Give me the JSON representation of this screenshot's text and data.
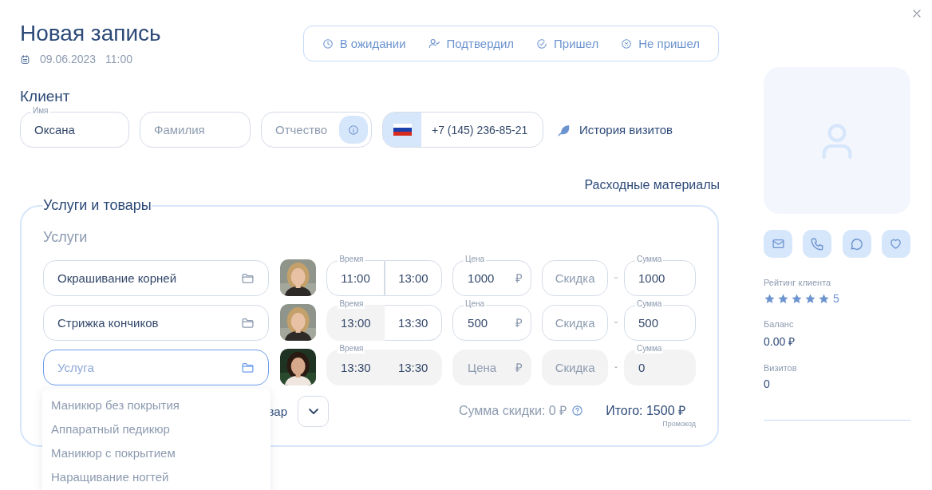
{
  "title": "Новая запись",
  "date": "09.06.2023",
  "time": "11:00",
  "statuses": [
    {
      "kind": "waiting",
      "label": "В ожидании"
    },
    {
      "kind": "confirmed",
      "label": "Подтвердил"
    },
    {
      "kind": "came",
      "label": "Пришел"
    },
    {
      "kind": "no_show",
      "label": "Не пришел"
    }
  ],
  "client": {
    "heading": "Клиент",
    "fields": [
      {
        "label": "Имя",
        "value": "Оксана"
      },
      {
        "placeholder": "Фамилия"
      },
      {
        "placeholder": "Отчество",
        "kind": "info"
      }
    ],
    "phone": "+7 (145) 236-85-21",
    "history_link": "История визитов"
  },
  "consumables_link": "Расходные материалы",
  "services_section": {
    "title": "Услуги и товары",
    "subtitle": "Услуги",
    "rows": [
      {
        "service": {
          "value": "Окрашивание корней",
          "focused": false
        },
        "time": {
          "label": "Время",
          "start": {
            "value": "11:00",
            "disabled": false
          },
          "end": {
            "value": "13:00",
            "disabled": false
          }
        },
        "price": {
          "label": "Цена",
          "value": "1000",
          "currency": "₽",
          "disabled": false
        },
        "discount": {
          "placeholder": "Скидка",
          "disabled": false
        },
        "sum": {
          "label": "Сумма",
          "value": "1000",
          "disabled": false
        }
      },
      {
        "service": {
          "value": "Стрижка кончиков",
          "focused": false
        },
        "time": {
          "label": "Время",
          "start": {
            "value": "13:00",
            "disabled": true
          },
          "end": {
            "value": "13:30",
            "disabled": false
          }
        },
        "price": {
          "label": "Цена",
          "value": "500",
          "currency": "₽",
          "disabled": false
        },
        "discount": {
          "placeholder": "Скидка",
          "disabled": false
        },
        "sum": {
          "label": "Сумма",
          "value": "500",
          "disabled": false
        }
      },
      {
        "service": {
          "placeholder": "Услуга",
          "focused": true
        },
        "time": {
          "label": "Время",
          "start": {
            "value": "13:30",
            "disabled": true
          },
          "end": {
            "value": "13:30",
            "disabled": true
          }
        },
        "price": {
          "placeholder": "Цена",
          "currency": "₽",
          "disabled": true
        },
        "discount": {
          "placeholder": "Скидка",
          "disabled": true
        },
        "sum": {
          "label": "Сумма",
          "value": "0",
          "disabled": true
        }
      }
    ],
    "dropdown": [
      "Маникюр без покрытия",
      "Аппаратный педикюр",
      "Маникюр с покрытием",
      "Наращивание ногтей"
    ],
    "add_label": "вар",
    "discount_total": "Сумма скидки: 0 ₽",
    "total": "Итого: 1500 ₽",
    "promo_link": "Промокод"
  },
  "profile": {
    "rating_label": "Рейтинг клиента",
    "stars": 5,
    "rating": "5",
    "balance_label": "Баланс",
    "balance": "0.00 ₽",
    "visits_label": "Визитов",
    "visits": "0"
  }
}
